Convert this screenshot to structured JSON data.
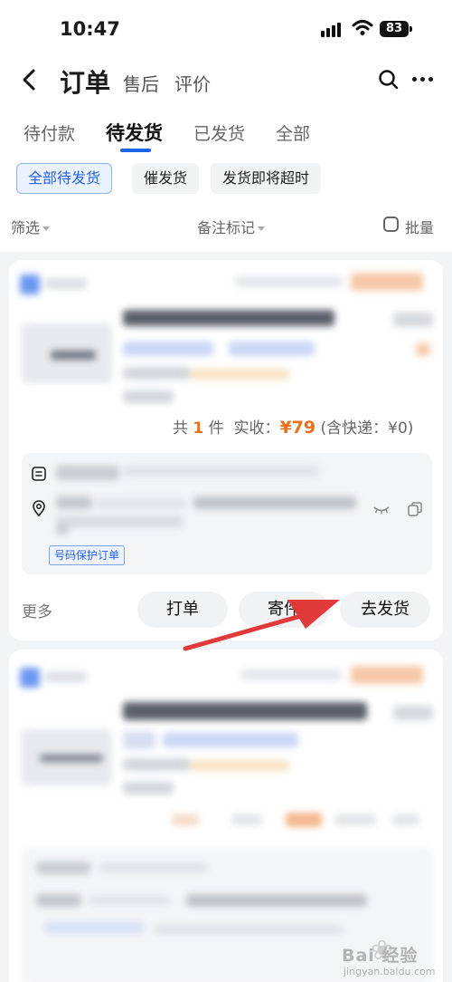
{
  "status_bar": {
    "time": "10:47",
    "battery": "83"
  },
  "nav": {
    "title": "订单",
    "sub_tabs": [
      "售后",
      "评价"
    ]
  },
  "order_tabs": [
    {
      "label": "待付款",
      "active": false
    },
    {
      "label": "待发货",
      "active": true
    },
    {
      "label": "已发货",
      "active": false
    },
    {
      "label": "全部",
      "active": false
    }
  ],
  "chips": [
    {
      "label": "全部待发货",
      "active": true
    },
    {
      "label": "催发货",
      "active": false
    },
    {
      "label": "发货即将超时",
      "active": false
    }
  ],
  "filters": {
    "filter_label": "筛选",
    "remark_label": "备注标记",
    "batch_label": "批量"
  },
  "order_card": {
    "summary_prefix": "共",
    "quantity": "1",
    "summary_unit": "件",
    "paid_label": "实收：",
    "paid_amount": "¥79",
    "shipping_note": "(含快递：¥0)",
    "protect_tag": "号码保护订单",
    "more_label": "更多",
    "actions": {
      "print": "打单",
      "send": "寄件",
      "ship": "去发货"
    }
  },
  "watermark": {
    "text": "Bai 经验",
    "url": "jingyan.baidu.com"
  },
  "colors": {
    "accent_blue": "#1d63e6",
    "price_orange": "#e8711c",
    "arrow_red": "#e03a3a"
  }
}
